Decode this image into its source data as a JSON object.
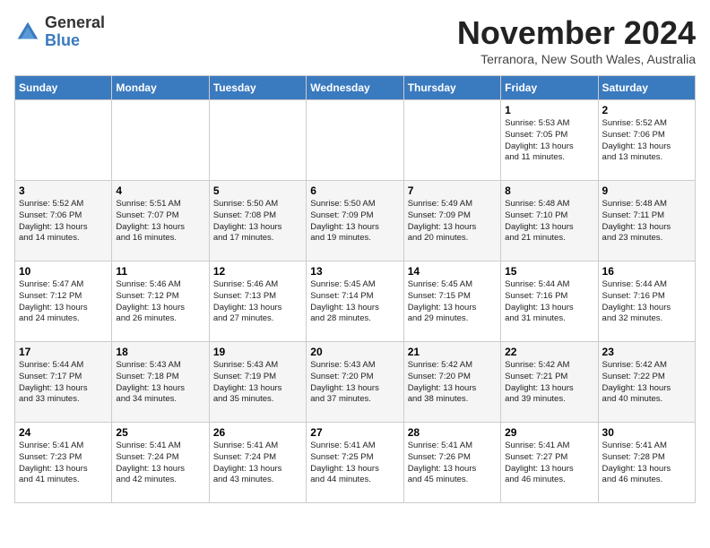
{
  "logo": {
    "general": "General",
    "blue": "Blue"
  },
  "title": "November 2024",
  "subtitle": "Terranora, New South Wales, Australia",
  "days_header": [
    "Sunday",
    "Monday",
    "Tuesday",
    "Wednesday",
    "Thursday",
    "Friday",
    "Saturday"
  ],
  "weeks": [
    [
      {
        "day": "",
        "info": ""
      },
      {
        "day": "",
        "info": ""
      },
      {
        "day": "",
        "info": ""
      },
      {
        "day": "",
        "info": ""
      },
      {
        "day": "",
        "info": ""
      },
      {
        "day": "1",
        "info": "Sunrise: 5:53 AM\nSunset: 7:05 PM\nDaylight: 13 hours\nand 11 minutes."
      },
      {
        "day": "2",
        "info": "Sunrise: 5:52 AM\nSunset: 7:06 PM\nDaylight: 13 hours\nand 13 minutes."
      }
    ],
    [
      {
        "day": "3",
        "info": "Sunrise: 5:52 AM\nSunset: 7:06 PM\nDaylight: 13 hours\nand 14 minutes."
      },
      {
        "day": "4",
        "info": "Sunrise: 5:51 AM\nSunset: 7:07 PM\nDaylight: 13 hours\nand 16 minutes."
      },
      {
        "day": "5",
        "info": "Sunrise: 5:50 AM\nSunset: 7:08 PM\nDaylight: 13 hours\nand 17 minutes."
      },
      {
        "day": "6",
        "info": "Sunrise: 5:50 AM\nSunset: 7:09 PM\nDaylight: 13 hours\nand 19 minutes."
      },
      {
        "day": "7",
        "info": "Sunrise: 5:49 AM\nSunset: 7:09 PM\nDaylight: 13 hours\nand 20 minutes."
      },
      {
        "day": "8",
        "info": "Sunrise: 5:48 AM\nSunset: 7:10 PM\nDaylight: 13 hours\nand 21 minutes."
      },
      {
        "day": "9",
        "info": "Sunrise: 5:48 AM\nSunset: 7:11 PM\nDaylight: 13 hours\nand 23 minutes."
      }
    ],
    [
      {
        "day": "10",
        "info": "Sunrise: 5:47 AM\nSunset: 7:12 PM\nDaylight: 13 hours\nand 24 minutes."
      },
      {
        "day": "11",
        "info": "Sunrise: 5:46 AM\nSunset: 7:12 PM\nDaylight: 13 hours\nand 26 minutes."
      },
      {
        "day": "12",
        "info": "Sunrise: 5:46 AM\nSunset: 7:13 PM\nDaylight: 13 hours\nand 27 minutes."
      },
      {
        "day": "13",
        "info": "Sunrise: 5:45 AM\nSunset: 7:14 PM\nDaylight: 13 hours\nand 28 minutes."
      },
      {
        "day": "14",
        "info": "Sunrise: 5:45 AM\nSunset: 7:15 PM\nDaylight: 13 hours\nand 29 minutes."
      },
      {
        "day": "15",
        "info": "Sunrise: 5:44 AM\nSunset: 7:16 PM\nDaylight: 13 hours\nand 31 minutes."
      },
      {
        "day": "16",
        "info": "Sunrise: 5:44 AM\nSunset: 7:16 PM\nDaylight: 13 hours\nand 32 minutes."
      }
    ],
    [
      {
        "day": "17",
        "info": "Sunrise: 5:44 AM\nSunset: 7:17 PM\nDaylight: 13 hours\nand 33 minutes."
      },
      {
        "day": "18",
        "info": "Sunrise: 5:43 AM\nSunset: 7:18 PM\nDaylight: 13 hours\nand 34 minutes."
      },
      {
        "day": "19",
        "info": "Sunrise: 5:43 AM\nSunset: 7:19 PM\nDaylight: 13 hours\nand 35 minutes."
      },
      {
        "day": "20",
        "info": "Sunrise: 5:43 AM\nSunset: 7:20 PM\nDaylight: 13 hours\nand 37 minutes."
      },
      {
        "day": "21",
        "info": "Sunrise: 5:42 AM\nSunset: 7:20 PM\nDaylight: 13 hours\nand 38 minutes."
      },
      {
        "day": "22",
        "info": "Sunrise: 5:42 AM\nSunset: 7:21 PM\nDaylight: 13 hours\nand 39 minutes."
      },
      {
        "day": "23",
        "info": "Sunrise: 5:42 AM\nSunset: 7:22 PM\nDaylight: 13 hours\nand 40 minutes."
      }
    ],
    [
      {
        "day": "24",
        "info": "Sunrise: 5:41 AM\nSunset: 7:23 PM\nDaylight: 13 hours\nand 41 minutes."
      },
      {
        "day": "25",
        "info": "Sunrise: 5:41 AM\nSunset: 7:24 PM\nDaylight: 13 hours\nand 42 minutes."
      },
      {
        "day": "26",
        "info": "Sunrise: 5:41 AM\nSunset: 7:24 PM\nDaylight: 13 hours\nand 43 minutes."
      },
      {
        "day": "27",
        "info": "Sunrise: 5:41 AM\nSunset: 7:25 PM\nDaylight: 13 hours\nand 44 minutes."
      },
      {
        "day": "28",
        "info": "Sunrise: 5:41 AM\nSunset: 7:26 PM\nDaylight: 13 hours\nand 45 minutes."
      },
      {
        "day": "29",
        "info": "Sunrise: 5:41 AM\nSunset: 7:27 PM\nDaylight: 13 hours\nand 46 minutes."
      },
      {
        "day": "30",
        "info": "Sunrise: 5:41 AM\nSunset: 7:28 PM\nDaylight: 13 hours\nand 46 minutes."
      }
    ]
  ]
}
